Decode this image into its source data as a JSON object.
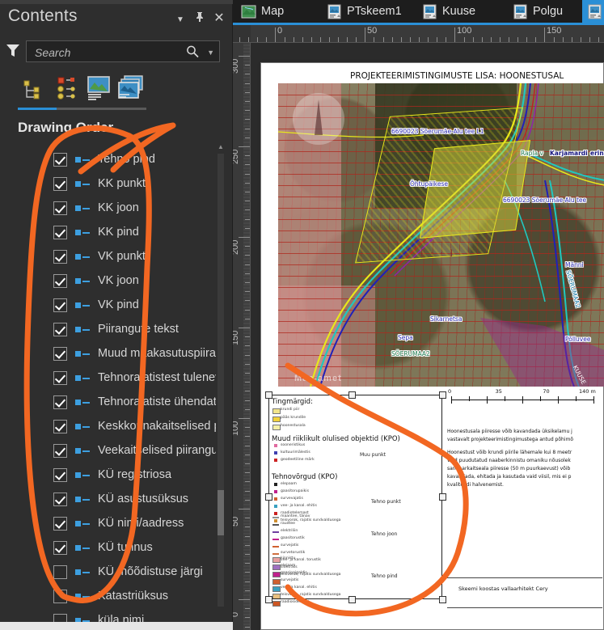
{
  "pane": {
    "title": "Contents",
    "menu_icon": "chevron-down-icon",
    "pin_icon": "pin-icon",
    "close_icon": "close-icon",
    "filter_icon": "filter-funnel-icon",
    "search_placeholder": "Search",
    "search_value": "",
    "search_icon": "magnifier-icon",
    "search_caret_icon": "chevron-down-icon",
    "section_title": "Drawing Order",
    "view_modes": [
      {
        "name": "list-by-drawing-order-icon",
        "active": true
      },
      {
        "name": "list-by-source-icon",
        "active": false
      },
      {
        "name": "list-by-selection-icon",
        "active": false
      },
      {
        "name": "list-by-snapping-icon",
        "active": false
      }
    ]
  },
  "layers": [
    {
      "label": "Tehno pind",
      "checked": true
    },
    {
      "label": "KK punkt",
      "checked": true
    },
    {
      "label": "KK joon",
      "checked": true
    },
    {
      "label": "KK pind",
      "checked": true
    },
    {
      "label": "VK punkt",
      "checked": true
    },
    {
      "label": "VK joon",
      "checked": true
    },
    {
      "label": "VK pind",
      "checked": true
    },
    {
      "label": "Piirangute tekst",
      "checked": true
    },
    {
      "label": "Muud maakasutuspiirar",
      "checked": true
    },
    {
      "label": "Tehnorajatistest tulenev",
      "checked": true
    },
    {
      "label": "Tehnorajatiste ühendatu",
      "checked": true
    },
    {
      "label": "Keskkonnakaitselised pi",
      "checked": true
    },
    {
      "label": "Veekaitselised piirangu",
      "checked": true
    },
    {
      "label": "KÜ registriosa",
      "checked": true
    },
    {
      "label": "KÜ asustusüksus",
      "checked": true
    },
    {
      "label": "KÜ nimi/aadress",
      "checked": true
    },
    {
      "label": "KÜ tunnus",
      "checked": true
    },
    {
      "label": "KÜ mõõdistuse järgi",
      "checked": false
    },
    {
      "label": "Katastriüksus",
      "checked": false
    },
    {
      "label": "küla nimi",
      "checked": false
    }
  ],
  "tabs": [
    {
      "label": "Map",
      "icon": "map-view-icon",
      "active": false
    },
    {
      "label": "PTskeem1",
      "icon": "layout-view-icon",
      "active": false
    },
    {
      "label": "Kuuse",
      "icon": "layout-view-icon",
      "active": false
    },
    {
      "label": "Polgu",
      "icon": "layout-view-icon",
      "active": false
    },
    {
      "label": "",
      "icon": "layout-view-icon",
      "active": true
    }
  ],
  "rulers": {
    "horizontal_labels": [
      "0",
      "50",
      "100",
      "150"
    ],
    "vertical_labels": [
      "300",
      "250",
      "200",
      "150",
      "100",
      "50",
      "0"
    ]
  },
  "layout": {
    "page_title": "PROJEKTEERIMISTINGIMUSTE LISA: HOONESTUSAL",
    "watermark": "Maa-amet",
    "map_labels": [
      {
        "text": "6690023 Sõerumäe-Alu tee L1",
        "style": "blue"
      },
      {
        "text": "Rapla v",
        "style": "green"
      },
      {
        "text": "Karjamardi",
        "style": "blue"
      },
      {
        "text": "erin",
        "style": "blue"
      },
      {
        "text": "Õhtupäikese",
        "style": "blue"
      },
      {
        "text": "6690023 Sõerumäe-Alu tee",
        "style": "blue"
      },
      {
        "text": "Sikarnetsa",
        "style": "blue"
      },
      {
        "text": "SÕERUMAA2",
        "style": "green"
      },
      {
        "text": "Männi",
        "style": "blue"
      },
      {
        "text": "Põlluvee",
        "style": "blue"
      },
      {
        "text": "SÕERUMAA2",
        "style": "teal"
      },
      {
        "text": "Sepa",
        "style": "blue"
      },
      {
        "text": "KUUSE",
        "style": "purple"
      }
    ],
    "legend": {
      "heading_1": "Tingmärgid:",
      "group_1": [
        {
          "label": "krundi piir",
          "color": "#f2e58a"
        },
        {
          "label": "pääs krundile",
          "color": "#f2d23a"
        },
        {
          "label": "hoonestusala",
          "color": "#f5f0a8"
        }
      ],
      "heading_2": "Muud riiklikult olulised objektid (KPO)",
      "group_2": [
        {
          "label": "sooneristikus",
          "color": "#e06aa0"
        },
        {
          "label": "kultuurimälestis",
          "color": "#4040b0"
        },
        {
          "label": "geodeetiline märk",
          "color": "#cc2222"
        }
      ],
      "group_2_caption": "Muu punkt",
      "heading_3": "Tehnovõrgud (KPO)",
      "group_3": [
        {
          "label": "elepaam",
          "color": "#222222"
        },
        {
          "label": "gaasitorupaikis",
          "color": "#c0208c"
        },
        {
          "label": "survevajatis",
          "color": "#d06030"
        },
        {
          "label": "vee- ja kanal. ehitis",
          "color": "#3aa0c0"
        },
        {
          "label": "raadiotelemast",
          "color": "#cc2222"
        },
        {
          "label": "teisvorok, rajatis sundvaldusega",
          "color": "#d09030"
        }
      ],
      "group_3_caption": "Tehno punkt",
      "group_4": [
        {
          "label": "maantee, tänav",
          "color": "#909090"
        },
        {
          "label": "raudtee",
          "color": "#555555"
        },
        {
          "label": "elektriliin",
          "color": "#7040a0"
        },
        {
          "label": "gaasitorustik",
          "color": "#c0208c"
        },
        {
          "label": "survejatis",
          "color": "#d06030"
        },
        {
          "label": "survetorustik",
          "color": "#d07040"
        },
        {
          "label": "vee- ja kanal. torustik",
          "color": "#3aa0c0"
        },
        {
          "label": "sidetrass",
          "color": "#a06030"
        },
        {
          "label": "teisvorok, rajatis sundvaldusega",
          "color": "#e0c060"
        }
      ],
      "group_4_caption": "Tehno joon",
      "group_5": [
        {
          "label": "kinnistu",
          "color": "#e8a0a0"
        },
        {
          "label": "elejaam",
          "color": "#a070c0"
        },
        {
          "label": "gaasipaigaldis",
          "color": "#c0208c"
        },
        {
          "label": "survejatis",
          "color": "#d06030"
        },
        {
          "label": "vee- ja kanal. ehitis",
          "color": "#3aa0c0"
        },
        {
          "label": "teisvorok, rajatis sundvaldusega",
          "color": "#e8c080"
        },
        {
          "label": "raadiosidemast",
          "color": "#cc5522"
        }
      ],
      "group_5_caption": "Tehno pind"
    },
    "scalebar": {
      "labels": [
        "0",
        "35",
        "70",
        "140 m"
      ]
    },
    "notes": [
      "Hoonestusala piiresse võib kavandada üksikelamu j",
      "vastavalt projekteerimistingimustega antud põhimõ",
      "Hoonestust võib krundi piirile lähemale kui 8 meetr",
      "vaid puudutatud naaberkinnistu omaniku nõusolek",
      "sanitaarkaitseala piiresse (50 m puurkaevust) võib",
      "kavandada, ehitada ja kasutada vaid viisil, mis ei p",
      "kvaliteedi halvenemist."
    ],
    "signature": "Skeemi koostas vallaarhitekt Cery"
  },
  "colors": {
    "accent": "#2a8fd6",
    "annotation": "#f26722",
    "panel_bg": "#2e2e2e",
    "page_bg": "#ffffff",
    "parcel_outline": "#e8e81a"
  }
}
